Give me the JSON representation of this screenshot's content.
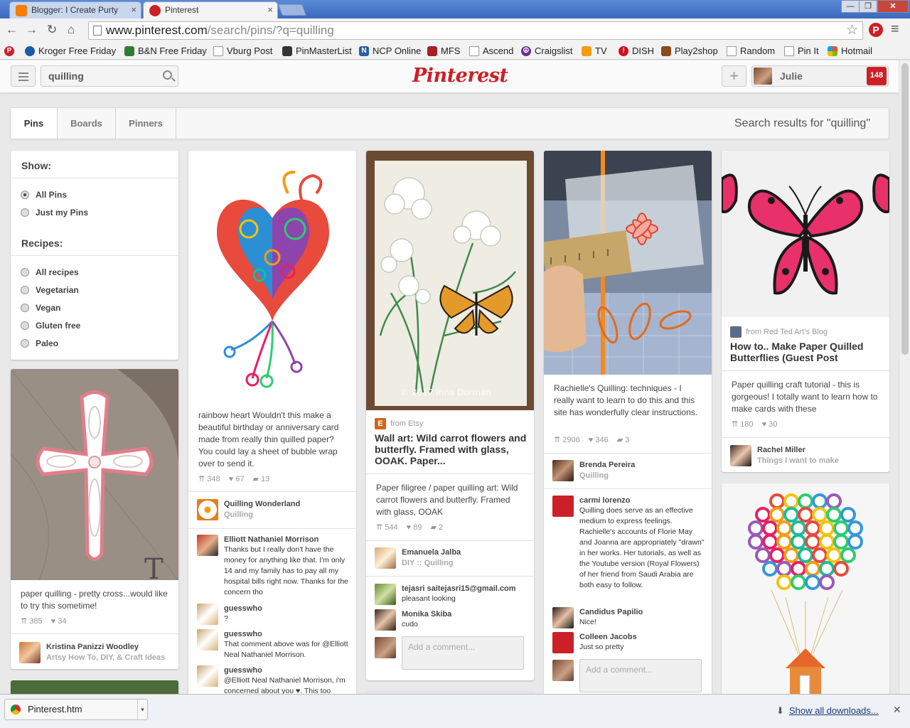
{
  "browser": {
    "tabs": [
      {
        "title": "Blogger: I Create Purty",
        "active": false
      },
      {
        "title": "Pinterest",
        "active": true
      }
    ],
    "url_host": "www.pinterest.com",
    "url_path": "/search/pins/?q=quilling",
    "bookmarks": [
      "Kroger Free Friday",
      "B&N Free Friday",
      "Vburg Post",
      "PinMasterList",
      "NCP Online",
      "MFS",
      "Ascend",
      "Craigslist",
      "TV",
      "DISH",
      "Play2shop",
      "Random",
      "Pin It",
      "Hotmail"
    ]
  },
  "header": {
    "search_value": "quilling",
    "logo": "Pinterest",
    "add_label": "+",
    "user_name": "Julie",
    "notifications": "148"
  },
  "filterbar": {
    "tabs": [
      "Pins",
      "Boards",
      "Pinners"
    ],
    "results_title": "Search results for \"quilling\""
  },
  "sidebar": {
    "show_title": "Show:",
    "show_options": [
      "All Pins",
      "Just my Pins"
    ],
    "recipes_title": "Recipes:",
    "recipe_options": [
      "All recipes",
      "Vegetarian",
      "Vegan",
      "Gluten free",
      "Paleo"
    ]
  },
  "pins": {
    "cross": {
      "desc": "paper quilling - pretty cross...would like to try this sometime!",
      "repins": "385",
      "likes": "34",
      "pinner": "Kristina Panizzi Woodley",
      "board": "Artsy How To, DIY, & Craft Ideas"
    },
    "heart": {
      "desc": "rainbow heart Wouldn't this make a beautiful birthday or anniversary card made from really thin quilled paper? You could lay a sheet of bubble wrap over to send it.",
      "repins": "348",
      "likes": "67",
      "comments": "13",
      "pinner": "Quilling Wonderland",
      "board": "Quilling",
      "comment_list": [
        {
          "name": "Elliott Nathaniel Morrison",
          "text": "Thanks but I really don't have the money for anything like that. I'm only 14 and my family has to pay all my hospital bills right now. Thanks for the concern tho"
        },
        {
          "name": "guesswho",
          "text": "?"
        },
        {
          "name": "guesswho",
          "text": "That comment above was for @Elliott Neal Nathaniel Morrison."
        },
        {
          "name": "guesswho",
          "text": "@Elliott Neal Nathaniel Morrison, i'm concerned about you ♥. This too"
        }
      ]
    },
    "carrot": {
      "watermark": "© 2012 Inna Dorman",
      "source": "from Etsy",
      "title": "Wall art: Wild carrot flowers and butterfly. Framed with glass, OOAK. Paper...",
      "desc": "Paper filigree / paper quilling art: Wild carrot flowers and butterfly. Framed with glass, OOAK",
      "repins": "544",
      "likes": "89",
      "comments": "2",
      "pinner": "Emanuela Jalba",
      "board": "DIY :: Quilling",
      "comment_list": [
        {
          "name": "tejasri saitejasri15@gmail.com",
          "text": "pleasant looking"
        },
        {
          "name": "Monika Skiba",
          "text": "cudo"
        }
      ],
      "add_comment": "Add a comment..."
    },
    "ruler": {
      "desc": "Rachielle's Quilling: techniques - I really want to learn to do this and this site has wonderfully clear instructions.",
      "repins": "2906",
      "likes": "346",
      "comments": "3",
      "pinner": "Brenda Pereira",
      "board": "Quilling",
      "comment_list": [
        {
          "name": "carmi lorenzo",
          "text": "Quilling does serve as an effective medium to express feelings. Rachielle's accounts of Florie May and Joanna are appropriately \"drawn\" in her works. Her tutorials, as well as the Youtube version (Royal Flowers) of her friend from Saudi Arabia are both easy to follow."
        },
        {
          "name": "Candidus Papilio",
          "text": "Nice!"
        },
        {
          "name": "Colleen Jacobs",
          "text": "Just so pretty"
        }
      ],
      "add_comment": "Add a comment..."
    },
    "butterfly": {
      "source": "from Red Ted Art's Blog",
      "title": "How to.. Make Paper Quilled Butterflies (Guest Post",
      "desc": "Paper quilling craft tutorial - this is gorgeous! I totally want to learn how to make cards with these",
      "repins": "180",
      "likes": "30",
      "pinner": "Rachel Miller",
      "board": "Things I want to make"
    }
  },
  "downloads": {
    "file": "Pinterest.htm",
    "show_all": "Show all downloads..."
  },
  "colors": {
    "brand": "#cb2027",
    "chrome": "#3e6fc4"
  }
}
